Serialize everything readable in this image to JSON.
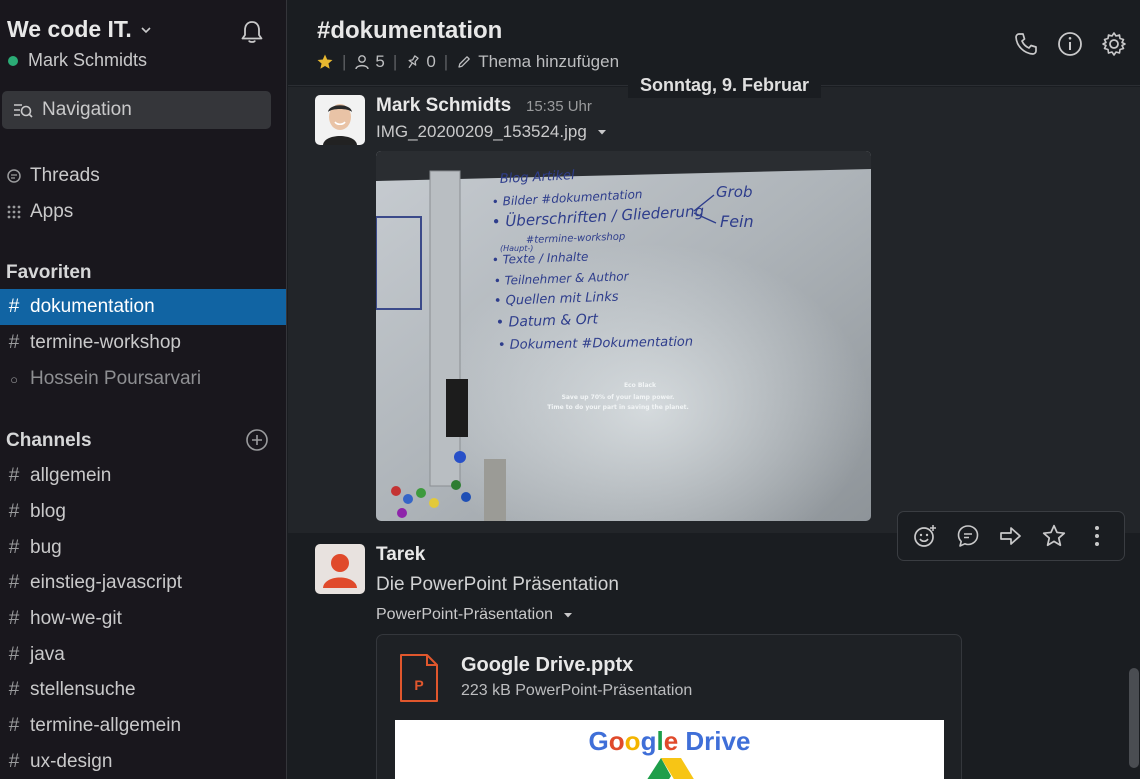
{
  "workspace": {
    "name": "We code IT.",
    "user": "Mark Schmidts"
  },
  "search": {
    "label": "Navigation"
  },
  "nav": {
    "threads": "Threads",
    "apps": "Apps"
  },
  "favorites": {
    "title": "Favoriten",
    "items": [
      {
        "prefix": "#",
        "label": "dokumentation"
      },
      {
        "prefix": "#",
        "label": "termine-workshop"
      },
      {
        "prefix": "○",
        "label": "Hossein Poursarvari"
      }
    ]
  },
  "channels": {
    "title": "Channels",
    "items": [
      {
        "label": "allgemein"
      },
      {
        "label": "blog"
      },
      {
        "label": "bug"
      },
      {
        "label": "einstieg-javascript"
      },
      {
        "label": "how-we-git"
      },
      {
        "label": "java"
      },
      {
        "label": "stellensuche"
      },
      {
        "label": "termine-allgemein"
      },
      {
        "label": "ux-design"
      }
    ]
  },
  "channel_header": {
    "title": "#dokumentation",
    "members": "5",
    "pins": "0",
    "topic": "Thema hinzufügen"
  },
  "date_divider": "Sonntag, 9. Februar",
  "messages": [
    {
      "author": "Mark Schmidts",
      "time": "15:35 Uhr",
      "file_name": "IMG_20200209_153524.jpg",
      "whiteboard": {
        "heading": "Blog Artikel",
        "lines": [
          "• Bilder #dokumentation",
          "• Überschriften / Gliederung",
          "#termine-workshop",
          "(Haupt-)",
          "• Texte / Inhalte",
          "• Teilnehmer & Author",
          "• Quellen mit Links",
          "• Datum & Ort",
          "• Dokument #Dokumentation"
        ],
        "side_top": "Grob",
        "side_bottom": "Fein",
        "projector_title": "Eco Black",
        "projector_line1": "Save up 70% of your lamp power.",
        "projector_line2": "Time to do your part in saving the planet."
      }
    },
    {
      "author": "Tarek",
      "text": "Die PowerPoint Präsentation",
      "file_label": "PowerPoint-Präsentation",
      "attachment": {
        "name": "Google Drive.pptx",
        "meta": "223 kB PowerPoint-Präsentation",
        "ppt_letter": "P",
        "preview_word1": "Google",
        "preview_word2": "Drive"
      }
    }
  ],
  "colors": {
    "sidebar_bg": "#19171d",
    "main_bg": "#1a1d21",
    "active_item": "#1164a3",
    "presence": "#2bac76",
    "star": "#e8b830",
    "ppt_orange": "#e0572d"
  },
  "icons": [
    "bell-icon",
    "search-icon",
    "threads-icon",
    "apps-icon",
    "add-channel-icon",
    "star-icon",
    "member-icon",
    "pin-icon",
    "edit-icon",
    "phone-icon",
    "info-icon",
    "gear-icon",
    "emoji-icon",
    "reply-icon",
    "share-icon",
    "bookmark-icon",
    "more-icon",
    "ppt-file-icon"
  ]
}
